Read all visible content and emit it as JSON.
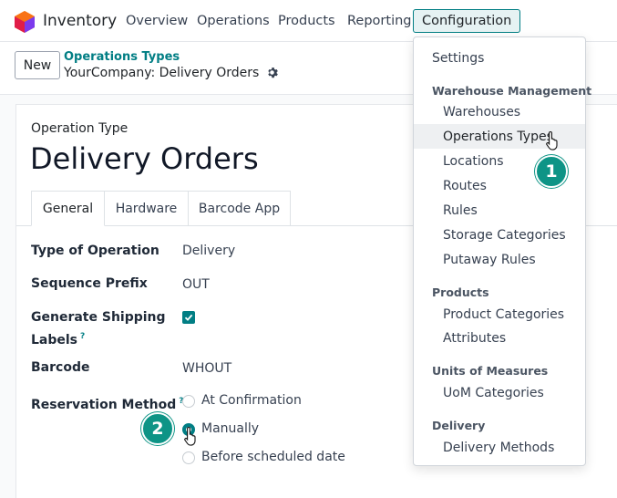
{
  "navbar": {
    "app_name": "Inventory",
    "menu": [
      "Overview",
      "Operations",
      "Products",
      "Reporting",
      "Configuration"
    ]
  },
  "control_panel": {
    "new_label": "New",
    "breadcrumb": "Operations Types",
    "record_title": "YourCompany: Delivery Orders"
  },
  "form": {
    "section_label": "Operation Type",
    "title": "Delivery Orders",
    "tabs": [
      "General",
      "Hardware",
      "Barcode App"
    ],
    "fields": {
      "type_of_operation": {
        "label": "Type of Operation",
        "value": "Delivery"
      },
      "sequence_prefix": {
        "label": "Sequence Prefix",
        "value": "OUT"
      },
      "generate_shipping_labels": {
        "label_line1": "Generate Shipping",
        "label_line2": "Labels",
        "checked": true
      },
      "barcode": {
        "label": "Barcode",
        "value": "WHOUT"
      },
      "reservation_method": {
        "label": "Reservation Method",
        "options": [
          "At Confirmation",
          "Manually",
          "Before scheduled date"
        ],
        "selected": "Manually"
      }
    },
    "help_mark": "?"
  },
  "dropdown": {
    "settings": "Settings",
    "warehouse_management": {
      "header": "Warehouse Management",
      "items": [
        "Warehouses",
        "Operations Types",
        "Locations",
        "Routes",
        "Rules",
        "Storage Categories",
        "Putaway Rules"
      ]
    },
    "products": {
      "header": "Products",
      "items": [
        "Product Categories",
        "Attributes"
      ]
    },
    "uom": {
      "header": "Units of Measures",
      "items": [
        "UoM Categories"
      ]
    },
    "delivery": {
      "header": "Delivery",
      "items": [
        "Delivery Methods"
      ]
    }
  },
  "steps": [
    "1",
    "2"
  ],
  "colors": {
    "primary": "#017e84",
    "badge": "#0e9486"
  }
}
